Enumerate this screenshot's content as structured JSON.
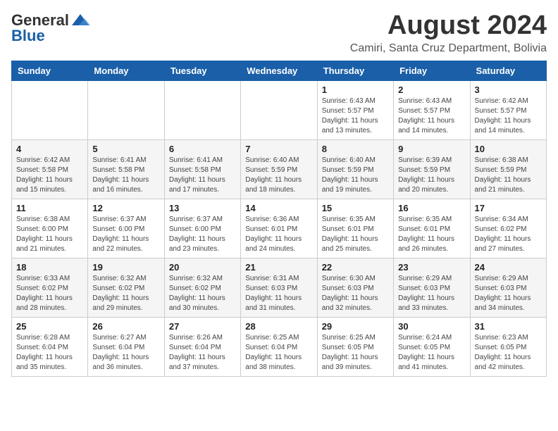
{
  "header": {
    "logo_general": "General",
    "logo_blue": "Blue",
    "month_title": "August 2024",
    "location": "Camiri, Santa Cruz Department, Bolivia"
  },
  "days_of_week": [
    "Sunday",
    "Monday",
    "Tuesday",
    "Wednesday",
    "Thursday",
    "Friday",
    "Saturday"
  ],
  "weeks": [
    [
      {
        "day": "",
        "info": ""
      },
      {
        "day": "",
        "info": ""
      },
      {
        "day": "",
        "info": ""
      },
      {
        "day": "",
        "info": ""
      },
      {
        "day": "1",
        "sunrise": "6:43 AM",
        "sunset": "5:57 PM",
        "daylight": "11 hours and 13 minutes."
      },
      {
        "day": "2",
        "sunrise": "6:43 AM",
        "sunset": "5:57 PM",
        "daylight": "11 hours and 14 minutes."
      },
      {
        "day": "3",
        "sunrise": "6:42 AM",
        "sunset": "5:57 PM",
        "daylight": "11 hours and 14 minutes."
      }
    ],
    [
      {
        "day": "4",
        "sunrise": "6:42 AM",
        "sunset": "5:58 PM",
        "daylight": "11 hours and 15 minutes."
      },
      {
        "day": "5",
        "sunrise": "6:41 AM",
        "sunset": "5:58 PM",
        "daylight": "11 hours and 16 minutes."
      },
      {
        "day": "6",
        "sunrise": "6:41 AM",
        "sunset": "5:58 PM",
        "daylight": "11 hours and 17 minutes."
      },
      {
        "day": "7",
        "sunrise": "6:40 AM",
        "sunset": "5:59 PM",
        "daylight": "11 hours and 18 minutes."
      },
      {
        "day": "8",
        "sunrise": "6:40 AM",
        "sunset": "5:59 PM",
        "daylight": "11 hours and 19 minutes."
      },
      {
        "day": "9",
        "sunrise": "6:39 AM",
        "sunset": "5:59 PM",
        "daylight": "11 hours and 20 minutes."
      },
      {
        "day": "10",
        "sunrise": "6:38 AM",
        "sunset": "5:59 PM",
        "daylight": "11 hours and 21 minutes."
      }
    ],
    [
      {
        "day": "11",
        "sunrise": "6:38 AM",
        "sunset": "6:00 PM",
        "daylight": "11 hours and 21 minutes."
      },
      {
        "day": "12",
        "sunrise": "6:37 AM",
        "sunset": "6:00 PM",
        "daylight": "11 hours and 22 minutes."
      },
      {
        "day": "13",
        "sunrise": "6:37 AM",
        "sunset": "6:00 PM",
        "daylight": "11 hours and 23 minutes."
      },
      {
        "day": "14",
        "sunrise": "6:36 AM",
        "sunset": "6:01 PM",
        "daylight": "11 hours and 24 minutes."
      },
      {
        "day": "15",
        "sunrise": "6:35 AM",
        "sunset": "6:01 PM",
        "daylight": "11 hours and 25 minutes."
      },
      {
        "day": "16",
        "sunrise": "6:35 AM",
        "sunset": "6:01 PM",
        "daylight": "11 hours and 26 minutes."
      },
      {
        "day": "17",
        "sunrise": "6:34 AM",
        "sunset": "6:02 PM",
        "daylight": "11 hours and 27 minutes."
      }
    ],
    [
      {
        "day": "18",
        "sunrise": "6:33 AM",
        "sunset": "6:02 PM",
        "daylight": "11 hours and 28 minutes."
      },
      {
        "day": "19",
        "sunrise": "6:32 AM",
        "sunset": "6:02 PM",
        "daylight": "11 hours and 29 minutes."
      },
      {
        "day": "20",
        "sunrise": "6:32 AM",
        "sunset": "6:02 PM",
        "daylight": "11 hours and 30 minutes."
      },
      {
        "day": "21",
        "sunrise": "6:31 AM",
        "sunset": "6:03 PM",
        "daylight": "11 hours and 31 minutes."
      },
      {
        "day": "22",
        "sunrise": "6:30 AM",
        "sunset": "6:03 PM",
        "daylight": "11 hours and 32 minutes."
      },
      {
        "day": "23",
        "sunrise": "6:29 AM",
        "sunset": "6:03 PM",
        "daylight": "11 hours and 33 minutes."
      },
      {
        "day": "24",
        "sunrise": "6:29 AM",
        "sunset": "6:03 PM",
        "daylight": "11 hours and 34 minutes."
      }
    ],
    [
      {
        "day": "25",
        "sunrise": "6:28 AM",
        "sunset": "6:04 PM",
        "daylight": "11 hours and 35 minutes."
      },
      {
        "day": "26",
        "sunrise": "6:27 AM",
        "sunset": "6:04 PM",
        "daylight": "11 hours and 36 minutes."
      },
      {
        "day": "27",
        "sunrise": "6:26 AM",
        "sunset": "6:04 PM",
        "daylight": "11 hours and 37 minutes."
      },
      {
        "day": "28",
        "sunrise": "6:25 AM",
        "sunset": "6:04 PM",
        "daylight": "11 hours and 38 minutes."
      },
      {
        "day": "29",
        "sunrise": "6:25 AM",
        "sunset": "6:05 PM",
        "daylight": "11 hours and 39 minutes."
      },
      {
        "day": "30",
        "sunrise": "6:24 AM",
        "sunset": "6:05 PM",
        "daylight": "11 hours and 41 minutes."
      },
      {
        "day": "31",
        "sunrise": "6:23 AM",
        "sunset": "6:05 PM",
        "daylight": "11 hours and 42 minutes."
      }
    ]
  ],
  "labels": {
    "sunrise": "Sunrise:",
    "sunset": "Sunset:",
    "daylight": "Daylight hours"
  }
}
